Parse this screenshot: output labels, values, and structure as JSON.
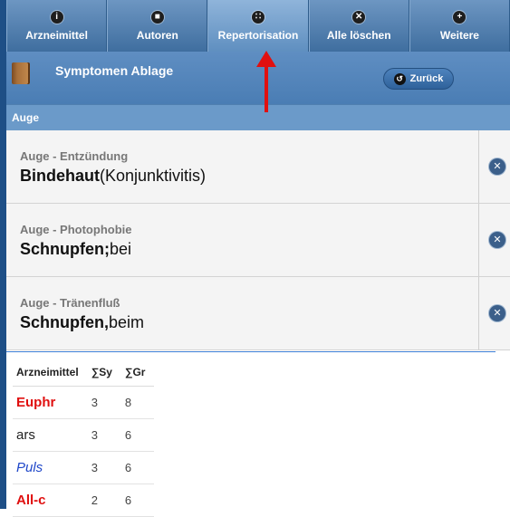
{
  "tabs": [
    {
      "label": "Arzneimittel",
      "icon": "info-icon"
    },
    {
      "label": "Autoren",
      "icon": "person-icon"
    },
    {
      "label": "Repertorisation",
      "icon": "grid-icon"
    },
    {
      "label": "Alle löschen",
      "icon": "close-circle-icon"
    },
    {
      "label": "Weitere",
      "icon": "plus-circle-icon"
    }
  ],
  "header": {
    "title": "Symptomen Ablage",
    "back_label": "Zurück"
  },
  "section": {
    "title": "Auge"
  },
  "symptoms": [
    {
      "category": "Auge - Entzündung",
      "bold": "Bindehaut",
      "rest": "(Konjunktivitis)"
    },
    {
      "category": "Auge - Photophobie",
      "bold": "Schnupfen;",
      "rest": "bei"
    },
    {
      "category": "Auge - Tränenfluß",
      "bold": "Schnupfen,",
      "rest": "beim"
    }
  ],
  "table": {
    "headers": [
      "Arzneimittel",
      "∑Sy",
      "∑Gr"
    ],
    "rows": [
      {
        "name": "Euphr",
        "sy": "3",
        "gr": "8",
        "color": "#e01010",
        "style": "bold"
      },
      {
        "name": "ars",
        "sy": "3",
        "gr": "6",
        "color": "#222222",
        "style": "normal"
      },
      {
        "name": "Puls",
        "sy": "3",
        "gr": "6",
        "color": "#1f47c9",
        "style": "italic"
      },
      {
        "name": "All-c",
        "sy": "2",
        "gr": "6",
        "color": "#e01010",
        "style": "bold"
      }
    ]
  },
  "colors": {
    "accent": "#4a7db4",
    "arrow": "#e01010"
  }
}
